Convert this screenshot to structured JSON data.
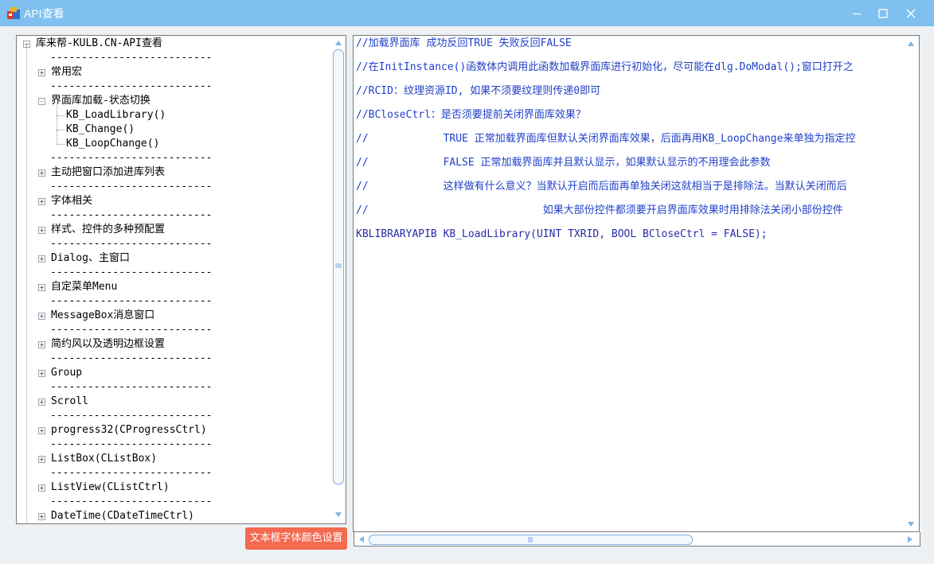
{
  "window": {
    "title": "API查看",
    "icons": {
      "app": "app-icon",
      "minimize": "minimize-icon",
      "maximize": "maximize-icon",
      "close": "close-icon"
    }
  },
  "tree": {
    "root_label": "库来帮-KULB.CN-API查看",
    "separator": "--------------------------",
    "nodes": [
      {
        "label": "常用宏",
        "expander": "+"
      },
      {
        "label": "界面库加载-状态切换",
        "expander": "-"
      },
      {
        "label": "主动把窗口添加进库列表",
        "expander": "+"
      },
      {
        "label": "字体相关",
        "expander": "+"
      },
      {
        "label": "样式、控件的多种预配置",
        "expander": "+"
      },
      {
        "label": "Dialog、主窗口",
        "expander": "+"
      },
      {
        "label": "自定菜单Menu",
        "expander": "+"
      },
      {
        "label": "MessageBox消息窗口",
        "expander": "+"
      },
      {
        "label": "简约风以及透明边框设置",
        "expander": "+"
      },
      {
        "label": "Group",
        "expander": "+"
      },
      {
        "label": "Scroll",
        "expander": "+"
      },
      {
        "label": "progress32(CProgressCtrl)",
        "expander": "+"
      },
      {
        "label": "ListBox(CListBox)",
        "expander": "+"
      },
      {
        "label": "ListView(CListCtrl)",
        "expander": "+"
      },
      {
        "label": "DateTime(CDateTimeCtrl)",
        "expander": "+"
      }
    ],
    "children": [
      "KB_LoadLibrary()",
      "KB_Change()",
      "KB_LoopChange()"
    ]
  },
  "code": {
    "lines": [
      "//加载界面库 成功反回TRUE 失败反回FALSE",
      "//在InitInstance()函数体内调用此函数加载界面库进行初始化，尽可能在dlg.DoModal();窗口打开之",
      "//RCID：纹理资源ID, 如果不须要纹理则传递0即可",
      "//BCloseCtrl：是否须要提前关闭界面库效果？",
      "//            TRUE 正常加载界面库但默认关闭界面库效果，后面再用KB_LoopChange来单独为指定控",
      "//            FALSE 正常加载界面库并且默认显示，如果默认显示的不用理会此参数",
      "//            这样做有什么意义？当默认开启而后面再单独关闭这就相当于是排除法。当默认关闭而后",
      "//                            如果大部份控件都须要开启界面库效果时用排除法关闭小部份控件",
      "KBLIBRARYAPIB KB_LoadLibrary(UINT TXRID, BOOL BCloseCtrl = FALSE);"
    ]
  },
  "buttons": {
    "text_color_label": "文本框字体颜色设置"
  },
  "scrollbars": {
    "tree_vertical_position": 0,
    "code_horizontal_position": 0
  },
  "colors": {
    "titlebar": "#7fc0f0",
    "code_text": "#2040c8",
    "color_button": "#f26a4f"
  }
}
